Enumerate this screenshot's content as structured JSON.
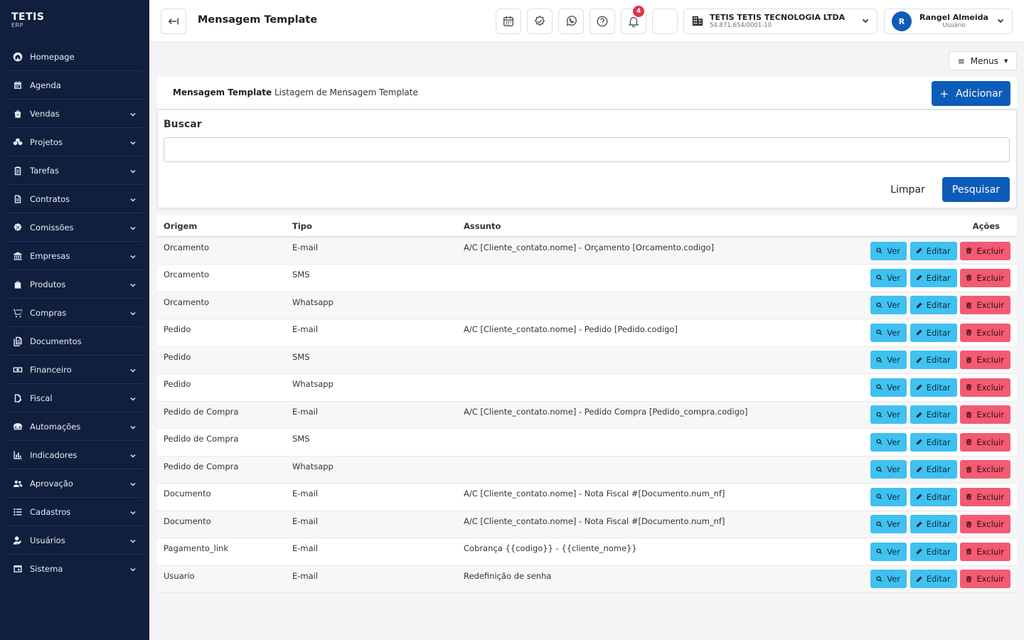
{
  "brand": {
    "name": "TETIS",
    "sub": "ERP"
  },
  "sidebar": {
    "items": [
      {
        "label": "Homepage",
        "icon": "home-icon",
        "expandable": false
      },
      {
        "label": "Agenda",
        "icon": "calendar-icon",
        "expandable": false
      },
      {
        "label": "Vendas",
        "icon": "shopping-bag-icon",
        "expandable": true
      },
      {
        "label": "Projetos",
        "icon": "cubes-icon",
        "expandable": true
      },
      {
        "label": "Tarefas",
        "icon": "clipboard-icon",
        "expandable": true
      },
      {
        "label": "Contratos",
        "icon": "contract-icon",
        "expandable": true
      },
      {
        "label": "Comissões",
        "icon": "badge-percent-icon",
        "expandable": true
      },
      {
        "label": "Empresas",
        "icon": "bank-icon",
        "expandable": true
      },
      {
        "label": "Produtos",
        "icon": "box-bag-icon",
        "expandable": true
      },
      {
        "label": "Compras",
        "icon": "cart-icon",
        "expandable": true
      },
      {
        "label": "Documentos",
        "icon": "documents-icon",
        "expandable": false
      },
      {
        "label": "Financeiro",
        "icon": "money-icon",
        "expandable": true
      },
      {
        "label": "Fiscal",
        "icon": "file-edit-icon",
        "expandable": true
      },
      {
        "label": "Automações",
        "icon": "robot-icon",
        "expandable": true
      },
      {
        "label": "Indicadores",
        "icon": "bar-chart-icon",
        "expandable": true
      },
      {
        "label": "Aprovação",
        "icon": "users-check-icon",
        "expandable": true
      },
      {
        "label": "Cadastros",
        "icon": "list-icon",
        "expandable": true
      },
      {
        "label": "Usuários",
        "icon": "user-edit-icon",
        "expandable": true
      },
      {
        "label": "Sistema",
        "icon": "settings-window-icon",
        "expandable": true
      }
    ]
  },
  "header": {
    "title": "Mensagem Template",
    "notifications_count": "4",
    "company": {
      "name": "TETIS TETIS TECNOLOGIA LTDA",
      "cnpj": "54.871.654/0001-10"
    },
    "user": {
      "initial": "R",
      "name": "Rangel Almeida",
      "role": "Usuário"
    }
  },
  "main": {
    "menus_label": "Menus",
    "card_title": "Mensagem Template",
    "card_subtitle": "Listagem de Mensagem Template",
    "add_label": "Adicionar",
    "search": {
      "label": "Buscar",
      "value": "",
      "placeholder": "",
      "clear_label": "Limpar",
      "submit_label": "Pesquisar"
    },
    "table": {
      "columns": [
        "Origem",
        "Tipo",
        "Assunto",
        "Ações"
      ],
      "action_labels": {
        "view": "Ver",
        "edit": "Editar",
        "delete": "Excluir"
      },
      "rows": [
        {
          "origem": "Orcamento",
          "tipo": "E-mail",
          "assunto": "A/C [Cliente_contato.nome] - Orçamento [Orcamento.codigo]"
        },
        {
          "origem": "Orcamento",
          "tipo": "SMS",
          "assunto": ""
        },
        {
          "origem": "Orcamento",
          "tipo": "Whatsapp",
          "assunto": ""
        },
        {
          "origem": "Pedido",
          "tipo": "E-mail",
          "assunto": "A/C [Cliente_contato.nome] - Pedido [Pedido.codigo]"
        },
        {
          "origem": "Pedido",
          "tipo": "SMS",
          "assunto": ""
        },
        {
          "origem": "Pedido",
          "tipo": "Whatsapp",
          "assunto": ""
        },
        {
          "origem": "Pedido de Compra",
          "tipo": "E-mail",
          "assunto": "A/C [Cliente_contato.nome] - Pedido Compra [Pedido_compra.codigo]"
        },
        {
          "origem": "Pedido de Compra",
          "tipo": "SMS",
          "assunto": ""
        },
        {
          "origem": "Pedido de Compra",
          "tipo": "Whatsapp",
          "assunto": ""
        },
        {
          "origem": "Documento",
          "tipo": "E-mail",
          "assunto": "A/C [Cliente_contato.nome] - Nota Fiscal #[Documento.num_nf]"
        },
        {
          "origem": "Documento",
          "tipo": "E-mail",
          "assunto": "A/C [Cliente_contato.nome] - Nota Fiscal #[Documento.num_nf]"
        },
        {
          "origem": "Pagamento_link",
          "tipo": "E-mail",
          "assunto": "Cobrança {{codigo}} - {{cliente_nome}}"
        },
        {
          "origem": "Usuario",
          "tipo": "E-mail",
          "assunto": "Redefinição de senha"
        }
      ]
    }
  },
  "colors": {
    "sidebar_bg": "#0f1f3d",
    "primary": "#0d5cba",
    "info": "#3fc1f1",
    "danger": "#f25b72",
    "badge": "#e0344b"
  }
}
